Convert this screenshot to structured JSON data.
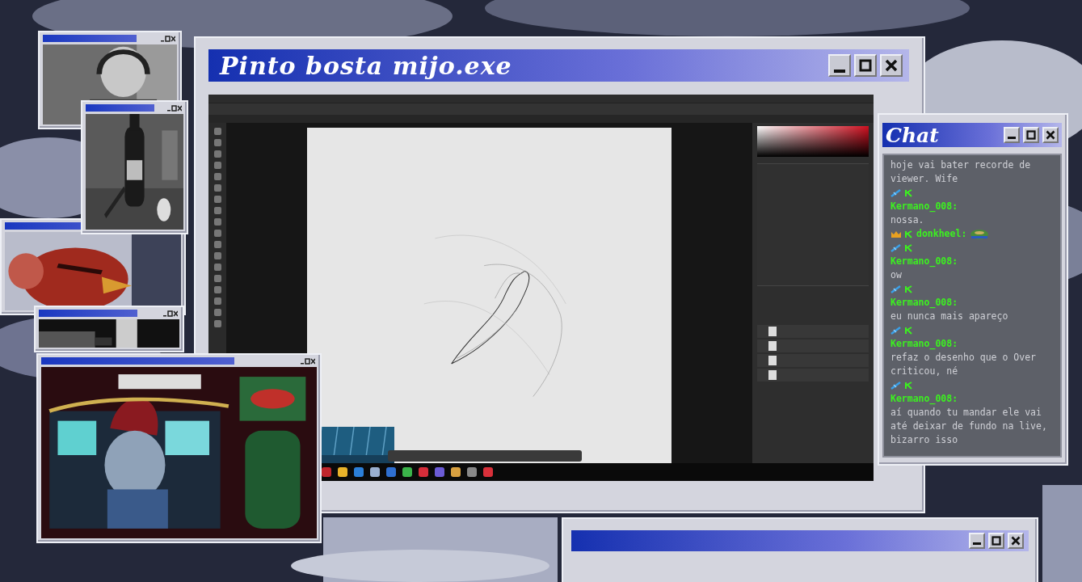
{
  "main_window": {
    "title": "Pinto bosta mijo.exe"
  },
  "chat": {
    "title": "Chat",
    "messages": [
      {
        "text": "hoje vai bater recorde de viewer. Wife"
      },
      {
        "badges": [
          {
            "kind": "pencil"
          },
          {
            "kind": "k"
          }
        ],
        "user": "Kermano_008:",
        "text": "nossa."
      },
      {
        "badges": [
          {
            "kind": "crown"
          },
          {
            "kind": "k"
          }
        ],
        "user": "donkheel:",
        "emote": true
      },
      {
        "badges": [
          {
            "kind": "pencil"
          },
          {
            "kind": "k"
          }
        ],
        "user": "Kermano_008:",
        "text": "ow"
      },
      {
        "badges": [
          {
            "kind": "pencil"
          },
          {
            "kind": "k"
          }
        ],
        "user": "Kermano_008:",
        "text": "eu nunca mais apareço"
      },
      {
        "badges": [
          {
            "kind": "pencil"
          },
          {
            "kind": "k"
          }
        ],
        "user": "Kermano_008:",
        "text": "refaz o desenho que o Over criticou, né"
      },
      {
        "badges": [
          {
            "kind": "pencil"
          },
          {
            "kind": "k"
          }
        ],
        "user": "Kermano_008:",
        "text": "aí quando tu mandar ele vai até deixar de fundo na live, bizarro isso"
      }
    ]
  }
}
